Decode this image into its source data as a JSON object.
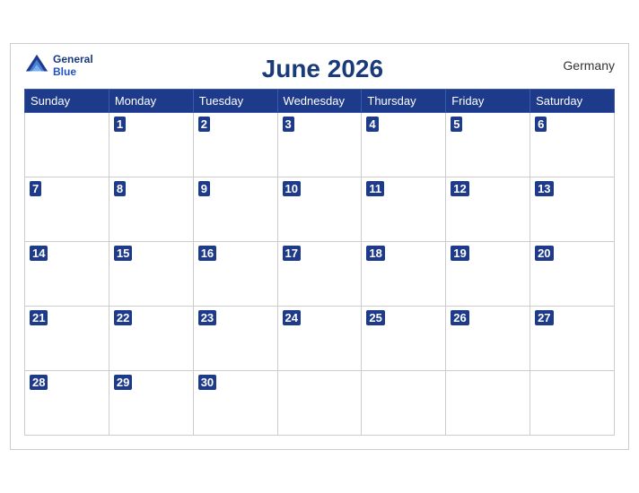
{
  "header": {
    "logo_general": "General",
    "logo_blue": "Blue",
    "title": "June 2026",
    "country": "Germany"
  },
  "weekdays": [
    "Sunday",
    "Monday",
    "Tuesday",
    "Wednesday",
    "Thursday",
    "Friday",
    "Saturday"
  ],
  "weeks": [
    [
      null,
      1,
      2,
      3,
      4,
      5,
      6
    ],
    [
      7,
      8,
      9,
      10,
      11,
      12,
      13
    ],
    [
      14,
      15,
      16,
      17,
      18,
      19,
      20
    ],
    [
      21,
      22,
      23,
      24,
      25,
      26,
      27
    ],
    [
      28,
      29,
      30,
      null,
      null,
      null,
      null
    ]
  ]
}
